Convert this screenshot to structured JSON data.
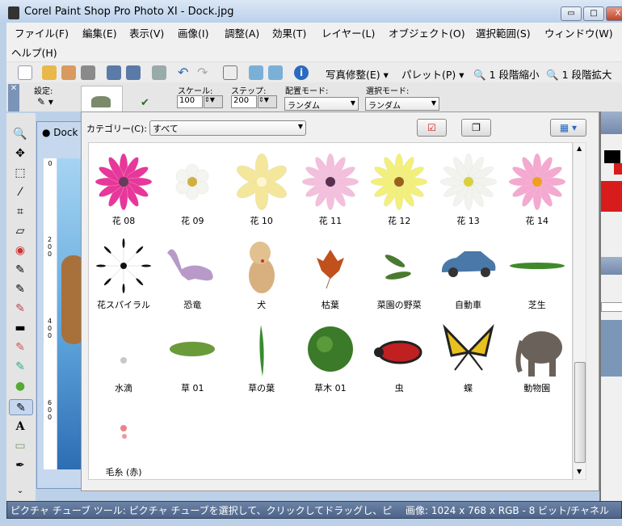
{
  "window": {
    "title": "Corel Paint Shop Pro Photo XI - Dock.jpg",
    "minimize": "▭",
    "maximize": "□",
    "close": "X"
  },
  "menu": [
    "ファイル(F)",
    "編集(E)",
    "表示(V)",
    "画像(I)",
    "調整(A)",
    "効果(T)",
    "レイヤー(L)",
    "オブジェクト(O)",
    "選択範囲(S)",
    "ウィンドウ(W)",
    "ヘルプ(H)"
  ],
  "toolbar": {
    "photo_fix": "写真修整(E) ▾",
    "palette": "パレット(P) ▾",
    "zoom_out": "1 段階縮小",
    "zoom_in": "1 段階拡大"
  },
  "options": {
    "preset_label": "設定:",
    "scale_label": "スケール:",
    "scale_value": "100",
    "step_label": "ステップ:",
    "step_value": "200",
    "placement_label": "配置モード:",
    "placement_value": "ランダム",
    "selection_label": "選択モード:",
    "selection_value": "ランダム"
  },
  "document": {
    "tab_label": "Dock",
    "ruler_marks": [
      "0",
      "200",
      "400",
      "600"
    ]
  },
  "dialog": {
    "category_label": "カテゴリー(C):",
    "category_value": "すべて"
  },
  "tubes": [
    {
      "name": "花 08",
      "kind": "flower",
      "color": "#e8379a",
      "center": "#6a3a5a"
    },
    {
      "name": "花 09",
      "kind": "flower",
      "color": "#f4f4f0",
      "center": "#d0b040"
    },
    {
      "name": "花 10",
      "kind": "flower",
      "color": "#f4e69a",
      "center": "#fff6d0"
    },
    {
      "name": "花 11",
      "kind": "flower",
      "color": "#f3bfdc",
      "center": "#5a3050"
    },
    {
      "name": "花 12",
      "kind": "flower",
      "color": "#f2f07a",
      "center": "#9a6020"
    },
    {
      "name": "花 13",
      "kind": "flower",
      "color": "#f2f2ee",
      "center": "#d8d040"
    },
    {
      "name": "花 14",
      "kind": "flower",
      "color": "#f5a8d0",
      "center": "#f0a020"
    },
    {
      "name": "花スパイラル",
      "kind": "spiral",
      "color": "#111111"
    },
    {
      "name": "恐竜",
      "kind": "dino",
      "color": "#b89ac8"
    },
    {
      "name": "犬",
      "kind": "dog",
      "color": "#d8b080"
    },
    {
      "name": "枯葉",
      "kind": "leaf",
      "color": "#c0501c"
    },
    {
      "name": "菜園の野菜",
      "kind": "peas",
      "color": "#4a7a30"
    },
    {
      "name": "自動車",
      "kind": "car",
      "color": "#4a78a8"
    },
    {
      "name": "芝生",
      "kind": "grass",
      "color": "#3e8a2a"
    },
    {
      "name": "水滴",
      "kind": "drop",
      "color": "#c8c8c8"
    },
    {
      "name": "草 01",
      "kind": "grass",
      "color": "#6a9a3a"
    },
    {
      "name": "草の葉",
      "kind": "blade",
      "color": "#3a8a30"
    },
    {
      "name": "草木 01",
      "kind": "bush",
      "color": "#3a7a28"
    },
    {
      "name": "虫",
      "kind": "bug",
      "color": "#c02020"
    },
    {
      "name": "蝶",
      "kind": "butterfly",
      "color": "#e8c020"
    },
    {
      "name": "動物園",
      "kind": "elephant",
      "color": "#6a625a"
    },
    {
      "name": "毛糸 (赤)",
      "kind": "yarn",
      "color": "#e03040"
    }
  ],
  "status": {
    "hint": "ピクチャ チューブ ツール: ピクチャ チューブを選択して、クリックしてドラッグし、ピ",
    "image_info": "画像:  1024 x 768 x RGB - 8 ビット/チャネル"
  },
  "colors": {
    "foreground": "#000000",
    "background": "#d81c1c"
  }
}
